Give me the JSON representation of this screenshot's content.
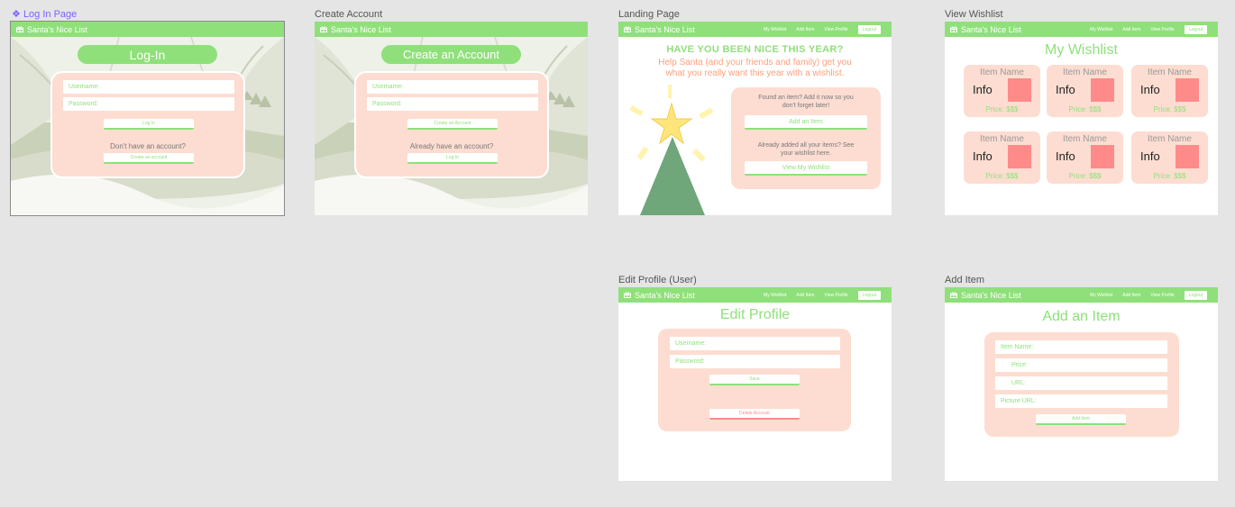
{
  "app": {
    "brand": "Santa's Nice List"
  },
  "nav": {
    "wishlist": "My Wishlist",
    "add": "Add Item",
    "profile": "View Profile",
    "logout": "Logout"
  },
  "colors": {
    "canvas": "#e5e5e5",
    "accent_green": "#8fe07a",
    "card_peach": "#fdddd1",
    "item_image": "#ff8a8a",
    "tree_green": "#6fa77b",
    "star_yellow": "#ffe57a"
  },
  "frames": {
    "login": {
      "label": "Log In Page",
      "title": "Log-In",
      "username_placeholder": "Username:",
      "password_placeholder": "Password:",
      "login_button": "Log In",
      "no_account_text": "Don't have an account?",
      "create_button": "Create an account"
    },
    "create": {
      "label": "Create Account",
      "title": "Create an Account",
      "username_placeholder": "Username:",
      "password_placeholder": "Password:",
      "create_button": "Create an Account",
      "have_account_text": "Already have an account?",
      "login_button": "Log In"
    },
    "landing": {
      "label": "Landing Page",
      "headline": "HAVE YOU BEEN NICE THIS YEAR?",
      "subhead_line1": "Help Santa (and your friends and family) get you",
      "subhead_line2": "what you really want this year with a wishlist.",
      "found_text_line1": "Found an item? Add it now so you",
      "found_text_line2": "don't forget later!",
      "add_button": "Add an Item",
      "added_text_line1": "Already added all your items? See",
      "added_text_line2": "your wishlist here.",
      "view_button": "View My Wishlist"
    },
    "wishlist": {
      "label": "View Wishlist",
      "title": "My Wishlist",
      "items": [
        {
          "name": "Item Name",
          "info": "Info",
          "price": "Price: $$$"
        },
        {
          "name": "Item Name",
          "info": "Info",
          "price": "Price: $$$"
        },
        {
          "name": "Item Name",
          "info": "Info",
          "price": "Price: $$$"
        },
        {
          "name": "Item Name",
          "info": "Info",
          "price": "Price: $$$"
        },
        {
          "name": "Item Name",
          "info": "Info",
          "price": "Price: $$$"
        },
        {
          "name": "Item Name",
          "info": "Info",
          "price": "Price: $$$"
        }
      ]
    },
    "edit": {
      "label": "Edit Profile (User)",
      "title": "Edit Profile",
      "username_placeholder": "Username:",
      "password_placeholder": "Password:",
      "save_button": "Save",
      "delete_button": "Delete Account"
    },
    "additem": {
      "label": "Add Item",
      "title": "Add an Item",
      "name_placeholder": "Item Name:",
      "price_placeholder": "Price:",
      "url_placeholder": "URL:",
      "picture_placeholder": "Picture URL:",
      "add_button": "Add Item"
    }
  }
}
